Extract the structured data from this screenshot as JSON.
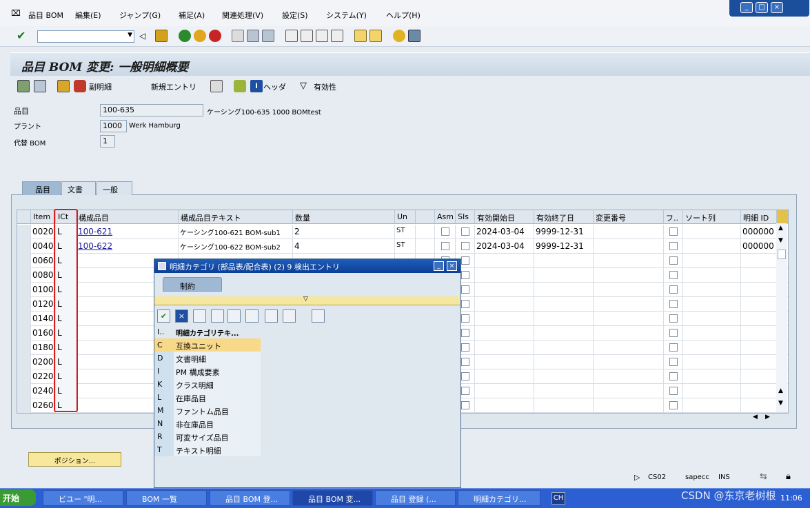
{
  "menu": {
    "items": [
      "品目 BOM",
      "編集(E)",
      "ジャンプ(G)",
      "補足(A)",
      "関連処理(V)",
      "設定(S)",
      "システム(Y)",
      "ヘルプ(H)"
    ]
  },
  "window_controls": [
    "_",
    "□",
    "×"
  ],
  "toolbar": {
    "command_field": ""
  },
  "title": "品目 BOM 変更: 一般明細概要",
  "app_toolbar": {
    "sub_item": "副明細",
    "new_entry": "新規エントリ",
    "header": "ヘッダ",
    "validity": "有効性"
  },
  "header": {
    "material_label": "品目",
    "material_value": "100-635",
    "material_desc": "ケーシング100-635 1000 BOMtest",
    "plant_label": "プラント",
    "plant_value": "1000",
    "plant_desc": "Werk Hamburg",
    "alt_bom_label": "代替 BOM",
    "alt_bom_value": "1"
  },
  "tabs": [
    "品目",
    "文書",
    "一般"
  ],
  "table": {
    "columns": [
      "Item",
      "ICt",
      "構成品目",
      "構成品目テキスト",
      "数量",
      "Un",
      "Asm",
      "SIs",
      "有効開始日",
      "有効終了日",
      "変更番号",
      "フ..",
      "ソート列",
      "明細 ID"
    ],
    "rows": [
      {
        "item": "0020",
        "ict": "L",
        "component": "100-621",
        "text": "ケーシング100-621 BOM-sub1",
        "qty": "2",
        "un": "ST",
        "valid_from": "2024-03-04",
        "valid_to": "9999-12-31",
        "item_id": "000000"
      },
      {
        "item": "0040",
        "ict": "L",
        "component": "100-622",
        "text": "ケーシング100-622 BOM-sub2",
        "qty": "4",
        "un": "ST",
        "valid_from": "2024-03-04",
        "valid_to": "9999-12-31",
        "item_id": "000000"
      },
      {
        "item": "0060",
        "ict": "L"
      },
      {
        "item": "0080",
        "ict": "L"
      },
      {
        "item": "0100",
        "ict": "L"
      },
      {
        "item": "0120",
        "ict": "L"
      },
      {
        "item": "0140",
        "ict": "L"
      },
      {
        "item": "0160",
        "ict": "L"
      },
      {
        "item": "0180",
        "ict": "L"
      },
      {
        "item": "0200",
        "ict": "L"
      },
      {
        "item": "0220",
        "ict": "L"
      },
      {
        "item": "0240",
        "ict": "L"
      },
      {
        "item": "0260",
        "ict": "L"
      }
    ]
  },
  "position_button": "ポジション...",
  "popup": {
    "title": "明細カテゴリ (部品表/配合表) (2)   9 検出エントリ",
    "tab": "制約",
    "col_key": "I..",
    "col_text": "明細カテゴリテキ...",
    "entries": [
      {
        "key": "C",
        "text": "互換ユニット"
      },
      {
        "key": "D",
        "text": "文書明細"
      },
      {
        "key": "I",
        "text": "PM 構成要素"
      },
      {
        "key": "K",
        "text": "クラス明細"
      },
      {
        "key": "L",
        "text": "在庫品目"
      },
      {
        "key": "M",
        "text": "ファントム品目"
      },
      {
        "key": "N",
        "text": "非在庫品目"
      },
      {
        "key": "R",
        "text": "可変サイズ品目"
      },
      {
        "key": "T",
        "text": "テキスト明細"
      }
    ]
  },
  "status": {
    "tcode": "CS02",
    "server": "sapecc",
    "mode": "INS"
  },
  "taskbar": {
    "start": "开始",
    "tasks": [
      "ビユー \"明...",
      "BOM 一覧",
      "品目 BOM 登...",
      "品目 BOM 変...",
      "品目 登録 (...",
      "明細カテゴリ..."
    ],
    "lang": "CH",
    "clock": "11:06"
  },
  "watermark": "CSDN @东京老树根"
}
